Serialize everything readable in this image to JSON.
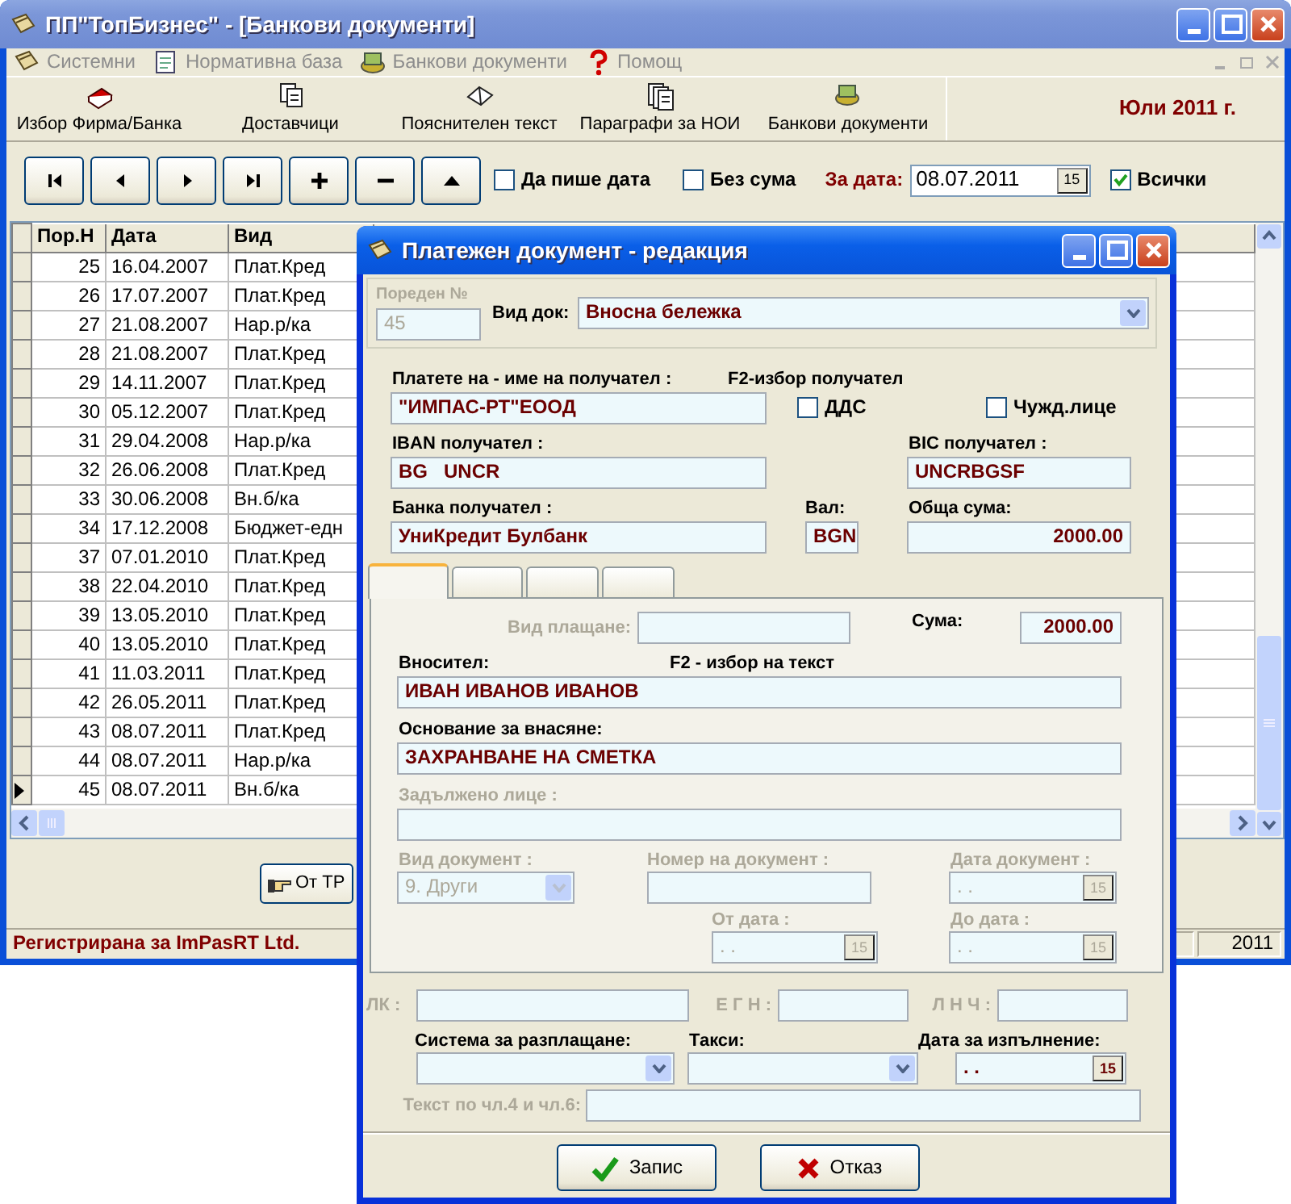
{
  "window": {
    "title": "ПП\"ТопБизнес\" - [Банкови документи]"
  },
  "menu": [
    {
      "label": "Системни"
    },
    {
      "label": "Нормативна база"
    },
    {
      "label": "Банкови документи"
    },
    {
      "label": "Помощ"
    }
  ],
  "toolbar": [
    {
      "label": "Избор Фирма/Банка"
    },
    {
      "label": "Доставчици"
    },
    {
      "label": "Пояснителен текст"
    },
    {
      "label": "Параграфи за НОИ"
    },
    {
      "label": "Банкови документи"
    }
  ],
  "period": "Юли 2011 г.",
  "filters": {
    "write_date": {
      "label": "Да пише дата",
      "checked": false
    },
    "no_sum": {
      "label": "Без сума",
      "checked": false
    },
    "date_label": "За дата:",
    "date": "08.07.2011",
    "calendar": "15",
    "all": {
      "label": "Всички",
      "checked": true
    }
  },
  "grid": {
    "columns": [
      "Пор.Н",
      "Дата",
      "Вид"
    ],
    "rows": [
      {
        "no": "25",
        "date": "16.04.2007",
        "type": "Плат.Кред",
        "selected": false
      },
      {
        "no": "26",
        "date": "17.07.2007",
        "type": "Плат.Кред",
        "selected": false
      },
      {
        "no": "27",
        "date": "21.08.2007",
        "type": "Нар.р/ка",
        "selected": false
      },
      {
        "no": "28",
        "date": "21.08.2007",
        "type": "Плат.Кред",
        "selected": false
      },
      {
        "no": "29",
        "date": "14.11.2007",
        "type": "Плат.Кред",
        "selected": false
      },
      {
        "no": "30",
        "date": "05.12.2007",
        "type": "Плат.Кред",
        "selected": false
      },
      {
        "no": "31",
        "date": "29.04.2008",
        "type": "Нар.р/ка",
        "selected": false
      },
      {
        "no": "32",
        "date": "26.06.2008",
        "type": "Плат.Кред",
        "selected": false
      },
      {
        "no": "33",
        "date": "30.06.2008",
        "type": "Вн.б/ка",
        "selected": false
      },
      {
        "no": "34",
        "date": "17.12.2008",
        "type": "Бюджет-едн",
        "selected": false
      },
      {
        "no": "37",
        "date": "07.01.2010",
        "type": "Плат.Кред",
        "selected": false
      },
      {
        "no": "38",
        "date": "22.04.2010",
        "type": "Плат.Кред",
        "selected": false
      },
      {
        "no": "39",
        "date": "13.05.2010",
        "type": "Плат.Кред",
        "selected": false
      },
      {
        "no": "40",
        "date": "13.05.2010",
        "type": "Плат.Кред",
        "selected": false
      },
      {
        "no": "41",
        "date": "11.03.2011",
        "type": "Плат.Кред",
        "selected": false
      },
      {
        "no": "42",
        "date": "26.05.2011",
        "type": "Плат.Кред",
        "selected": false
      },
      {
        "no": "43",
        "date": "08.07.2011",
        "type": "Плат.Кред",
        "selected": false
      },
      {
        "no": "44",
        "date": "08.07.2011",
        "type": "Нар.р/ка",
        "selected": false
      },
      {
        "no": "45",
        "date": "08.07.2011",
        "type": "Вн.б/ка",
        "selected": true
      }
    ]
  },
  "bottom_button": "От ТР",
  "status": {
    "text": "Регистрирана за ImPasRT Ltd.",
    "year": "2011"
  },
  "dialog": {
    "title": "Платежен документ - редакция",
    "number": {
      "label": "Пореден №",
      "value": "45",
      "disabled": true
    },
    "doc_type": {
      "label": "Вид док:",
      "value": "Вносна бележка",
      "disabled": false
    },
    "payee": {
      "label": "Платете на - име на получател :",
      "hint": "F2-избор получател",
      "value": "\"ИМПАС-РТ\"ЕООД",
      "disabled": false
    },
    "vat": {
      "label": "ДДС",
      "checked": false
    },
    "foreign": {
      "label": "Чужд.лице",
      "checked": false
    },
    "iban": {
      "label": "IBAN получател :",
      "value": "BG   UNCR",
      "disabled": false
    },
    "bic": {
      "label": "BIC получател :",
      "value": "UNCRBGSF",
      "disabled": false
    },
    "bank": {
      "label": "Банка получател :",
      "value": "УниКредит Булбанк",
      "disabled": false
    },
    "currency": {
      "label": "Вал:",
      "value": "BGN",
      "disabled": false
    },
    "total": {
      "label": "Обща сума:",
      "value": "2000.00",
      "disabled": false
    },
    "tabs": [
      {
        "selected": true
      },
      {
        "selected": false
      },
      {
        "selected": false
      },
      {
        "selected": false
      }
    ],
    "payment_type": {
      "label": "Вид плащане:",
      "disabled": true
    },
    "amount": {
      "label": "Сума:",
      "value": "2000.00",
      "disabled": false
    },
    "depositor": {
      "label": "Вносител:",
      "hint": "F2 - избор на текст",
      "value": "ИВАН ИВАНОВ ИВАНОВ",
      "disabled": false
    },
    "reason": {
      "label": "Основание за внасяне:",
      "value": "ЗАХРАНВАНЕ НА СМЕТКА",
      "disabled": false
    },
    "obliged": {
      "label": "Задължено лице :",
      "disabled": true
    },
    "doc_kind": {
      "label": "Вид документ :",
      "value": "9. Други",
      "disabled": true
    },
    "doc_number": {
      "label": "Номер на документ :",
      "disabled": true
    },
    "doc_date": {
      "label": "Дата документ :",
      "value": ". .",
      "calendar": "15",
      "disabled": true
    },
    "from_date": {
      "label": "От дата :",
      "value": ". .",
      "calendar": "15",
      "disabled": true
    },
    "to_date": {
      "label": "До дата :",
      "value": ". .",
      "calendar": "15",
      "disabled": true
    },
    "id_card": {
      "label": "ЛК :",
      "disabled": true
    },
    "egn": {
      "label": "Е Г Н :",
      "disabled": true
    },
    "lnch": {
      "label": "Л Н Ч :",
      "disabled": true
    },
    "system": {
      "label": "Система за разплащане:",
      "disabled": false
    },
    "fees": {
      "label": "Такси:",
      "disabled": false
    },
    "exec_date": {
      "label": "Дата за изпълнение:",
      "value": ". .",
      "calendar": "15",
      "disabled": false
    },
    "art_text": {
      "label": "Текст по чл.4 и чл.6:",
      "disabled": true
    },
    "buttons": [
      {
        "label": "Запис",
        "kind": "ok"
      },
      {
        "label": "Отказ",
        "kind": "cancel"
      }
    ]
  }
}
